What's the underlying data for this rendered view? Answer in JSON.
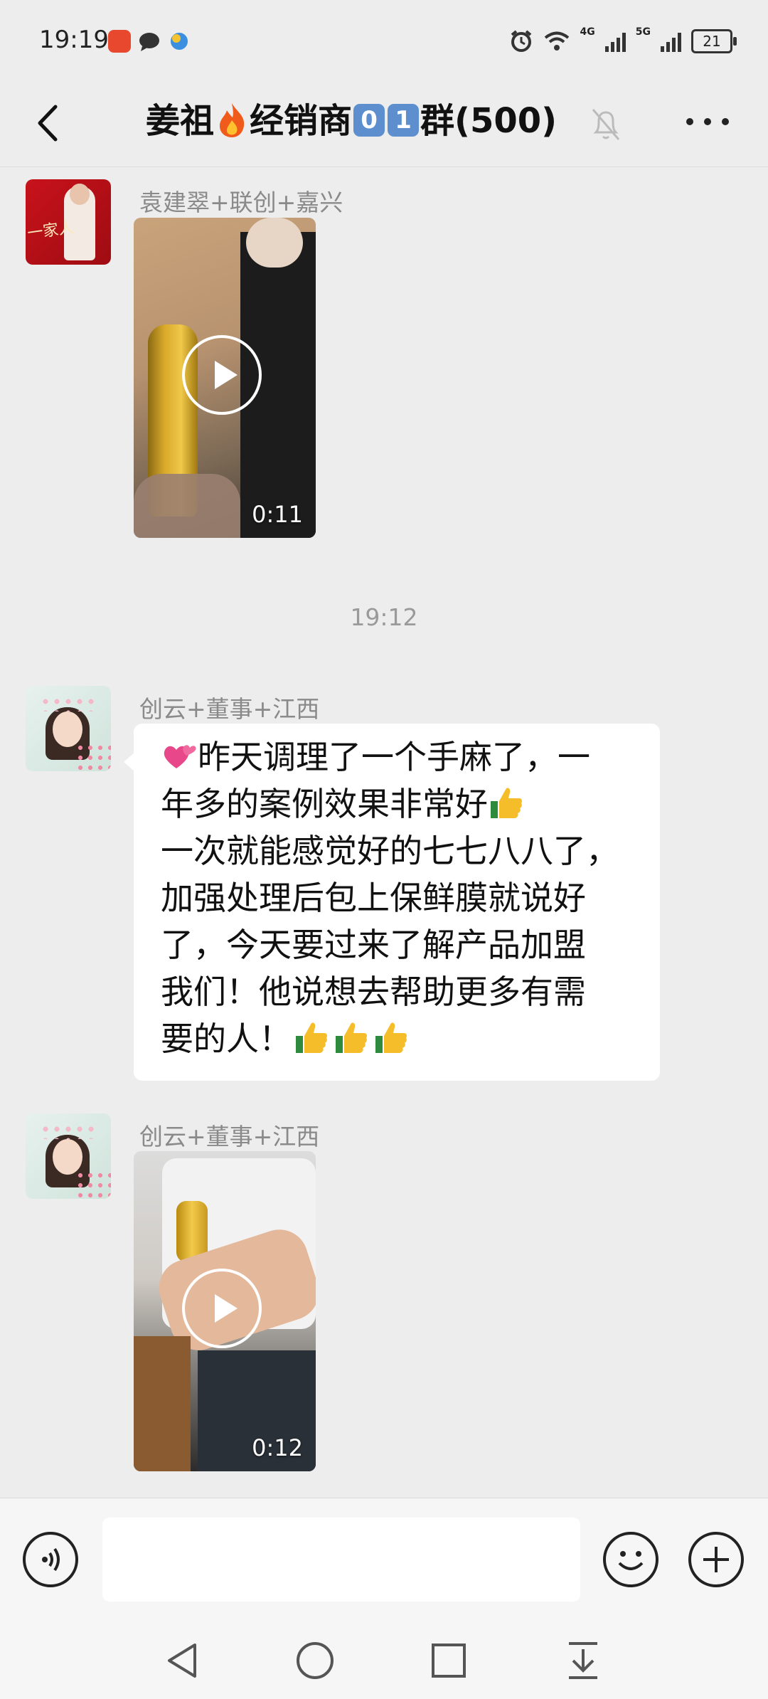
{
  "status_bar": {
    "time": "19:19",
    "battery": "21",
    "network_1": "4G",
    "network_2": "5G"
  },
  "header": {
    "title_part1": "姜祖",
    "title_part2": "经销商",
    "title_digit1": "0",
    "title_digit2": "1",
    "title_part3": "群(500)"
  },
  "messages": [
    {
      "type": "video",
      "sender": "袁建翠+联创+嘉兴",
      "duration": "0:11",
      "avatar_text": "一家人"
    },
    {
      "type": "timestamp",
      "text": "19:12"
    },
    {
      "type": "text",
      "sender": "创云+董事+江西",
      "lines": [
        "昨天调理了一个手麻了，一",
        "年多的案例效果非常好",
        "一次就能感觉好的七七八八了，",
        "加强处理后包上保鲜膜就说好",
        "了，今天要过来了解产品加盟",
        "我们！他说想去帮助更多有需",
        "要的人！"
      ]
    },
    {
      "type": "video",
      "sender": "创云+董事+江西",
      "duration": "0:12"
    }
  ],
  "icons": {
    "back": "chevron-left-icon",
    "mute": "bell-muted-icon",
    "more": "more-dots-icon",
    "voice": "voice-icon",
    "emoji": "emoji-icon",
    "plus": "plus-icon",
    "thumbs": "thumbs-up-icon",
    "hearts": "two-hearts-icon"
  },
  "colors": {
    "background": "#ededed",
    "bubble": "#ffffff",
    "keycap": "#5d8fcf",
    "sender": "#8a8a8a"
  }
}
